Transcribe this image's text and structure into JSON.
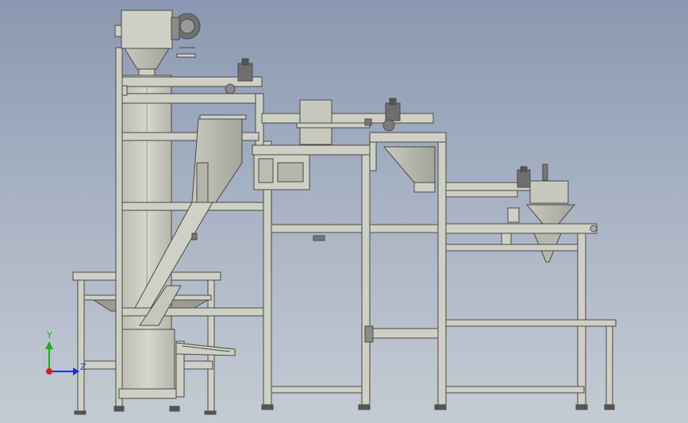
{
  "triad": {
    "y_label": "Y",
    "z_label": "Z",
    "y_color": "#22aa22",
    "x_color": "#2233cc",
    "z_color": "#cc2222"
  },
  "colors": {
    "steel": "#cfcfc5",
    "steel_dark": "#a9a9a0",
    "outline": "#4a4a48",
    "motor": "#6e7070",
    "shadow": "#b8b8ae"
  },
  "icons": {
    "triad": "coordinate-triad-icon"
  }
}
